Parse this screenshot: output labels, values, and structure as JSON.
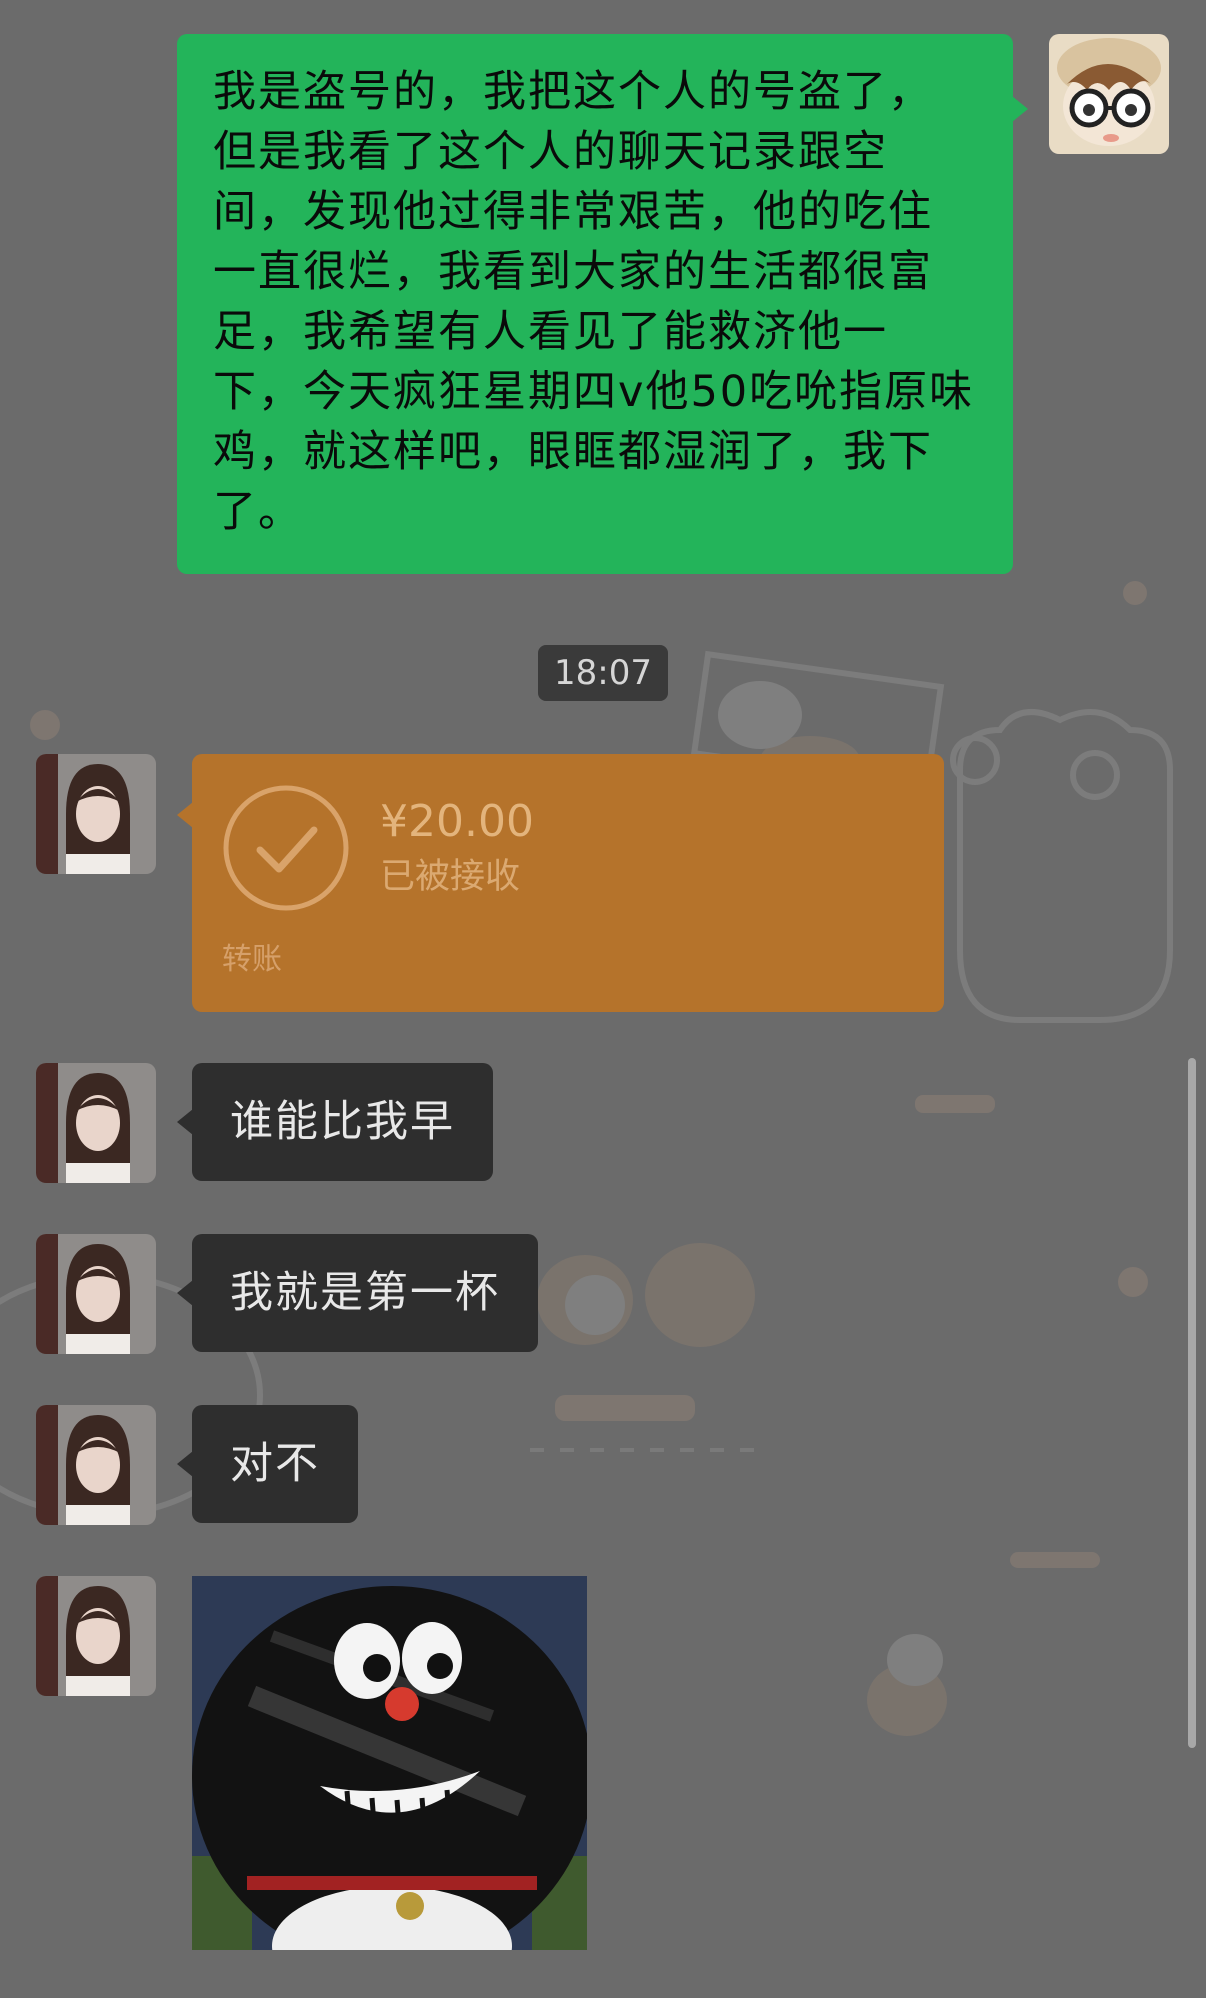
{
  "chat": {
    "messages": [
      {
        "type": "text",
        "direction": "outgoing",
        "text": "我是盗号的，我把这个人的号盗了，但是我看了这个人的聊天记录跟空间，发现他过得非常艰苦，他的吃住一直很烂，我看到大家的生活都很富足，我希望有人看见了能救济他一下，今天疯狂星期四v他50吃吮指原味鸡，就这样吧，眼眶都湿润了，我下了。"
      },
      {
        "type": "timestamp",
        "text": "18:07"
      },
      {
        "type": "transfer",
        "direction": "incoming",
        "amount": "¥20.00",
        "status": "已被接收",
        "label": "转账"
      },
      {
        "type": "text",
        "direction": "incoming",
        "text": "谁能比我早"
      },
      {
        "type": "text",
        "direction": "incoming",
        "text": "我就是第一杯"
      },
      {
        "type": "text",
        "direction": "incoming",
        "text": "对不"
      },
      {
        "type": "image",
        "direction": "incoming"
      }
    ]
  },
  "avatars": {
    "self": "cartoon-glasses-avatar",
    "contact": "girl-portrait-avatar"
  },
  "colors": {
    "outgoing_bubble": "#23b45a",
    "incoming_bubble": "#2e2e2e",
    "transfer_card": "#b5732b",
    "background": "#6b6b6b"
  }
}
